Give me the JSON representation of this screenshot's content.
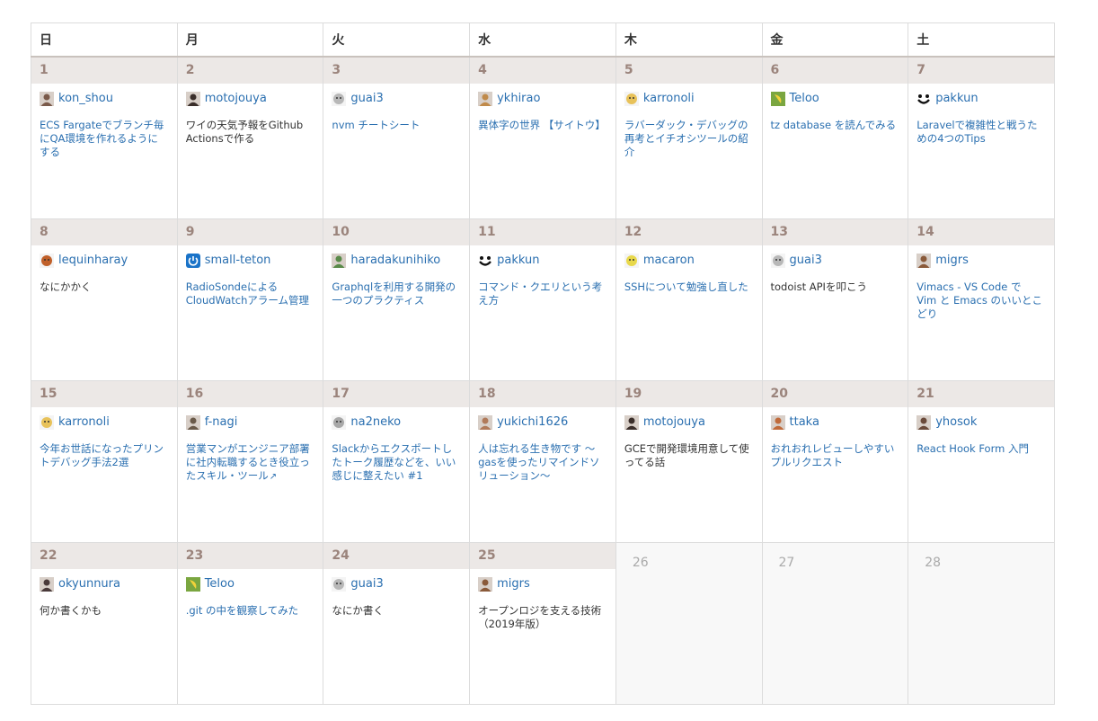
{
  "weekdays": [
    "日",
    "月",
    "火",
    "水",
    "木",
    "金",
    "土"
  ],
  "colors": {
    "link": "#2a6fb0",
    "day_header_bg": "#ece8e6",
    "day_number": "#9b847c",
    "empty_cell_bg": "#f8f8f8"
  },
  "weeks": [
    [
      {
        "day": "1",
        "author": "kon_shou",
        "avatar": "photo-avatar",
        "avatar_color": "#7a5a4a",
        "title": "ECS Fargateでブランチ毎にQA環境を作れるようにする",
        "linked": true
      },
      {
        "day": "2",
        "author": "motojouya",
        "avatar": "photo-avatar",
        "avatar_color": "#3a2e2a",
        "title": "ワイの天気予報をGithub Actionsで作る",
        "linked": false
      },
      {
        "day": "3",
        "author": "guai3",
        "avatar": "character-avatar",
        "avatar_color": "#b8b8b8",
        "title": "nvm チートシート",
        "linked": true
      },
      {
        "day": "4",
        "author": "ykhirao",
        "avatar": "photo-avatar",
        "avatar_color": "#c08a4a",
        "title": "異体字の世界 【サイトウ】",
        "linked": true
      },
      {
        "day": "5",
        "author": "karronoli",
        "avatar": "character-avatar",
        "avatar_color": "#e8c25a",
        "title": "ラバーダック・デバッグの再考とイチオシツールの紹介",
        "linked": true
      },
      {
        "day": "6",
        "author": "Teloo",
        "avatar": "banana-avatar",
        "avatar_color": "#7aa640",
        "title": "tz database を読んでみる",
        "linked": true
      },
      {
        "day": "7",
        "author": "pakkun",
        "avatar": "smiley-avatar",
        "avatar_color": "#111111",
        "title": "Laravelで複雑性と戦うための4つのTips",
        "linked": true
      }
    ],
    [
      {
        "day": "8",
        "author": "lequinharay",
        "avatar": "character-avatar",
        "avatar_color": "#c0602a",
        "title": "なにかかく",
        "linked": false
      },
      {
        "day": "9",
        "author": "small-teton",
        "avatar": "power-avatar",
        "avatar_color": "#1a73c8",
        "title": "RadioSondeによるCloudWatchアラーム管理",
        "linked": true
      },
      {
        "day": "10",
        "author": "haradakunihiko",
        "avatar": "photo-avatar",
        "avatar_color": "#5a8a4a",
        "title": "Graphqlを利用する開発の一つのプラクティス",
        "linked": true
      },
      {
        "day": "11",
        "author": "pakkun",
        "avatar": "smiley-avatar",
        "avatar_color": "#111111",
        "title": "コマンド・クエリという考え方",
        "linked": true
      },
      {
        "day": "12",
        "author": "macaron",
        "avatar": "character-avatar",
        "avatar_color": "#e8d84a",
        "title": "SSHについて勉強し直した",
        "linked": true
      },
      {
        "day": "13",
        "author": "guai3",
        "avatar": "character-avatar",
        "avatar_color": "#b8b8b8",
        "title": "todoist APIを叩こう",
        "linked": false
      },
      {
        "day": "14",
        "author": "migrs",
        "avatar": "photo-avatar",
        "avatar_color": "#8a5a3a",
        "title": "Vimacs - VS Code で Vim と Emacs のいいとこどり",
        "linked": true
      }
    ],
    [
      {
        "day": "15",
        "author": "karronoli",
        "avatar": "character-avatar",
        "avatar_color": "#e8c25a",
        "title": "今年お世話になったプリントデバッグ手法2選",
        "linked": true
      },
      {
        "day": "16",
        "author": "f-nagi",
        "avatar": "photo-avatar",
        "avatar_color": "#6a5a4a",
        "title": "営業マンがエンジニア部署に社内転職するとき役立ったスキル・ツール",
        "linked": true,
        "external": true
      },
      {
        "day": "17",
        "author": "na2neko",
        "avatar": "character-avatar",
        "avatar_color": "#a8a8a8",
        "title": "Slackからエクスポートしたトーク履歴などを、いい感じに整えたい #1",
        "linked": true
      },
      {
        "day": "18",
        "author": "yukichi1626",
        "avatar": "photo-avatar",
        "avatar_color": "#b07a5a",
        "title": "人は忘れる生き物です 〜gasを使ったリマインドソリューション〜",
        "linked": true
      },
      {
        "day": "19",
        "author": "motojouya",
        "avatar": "photo-avatar",
        "avatar_color": "#3a2e2a",
        "title": "GCEで開発環境用意して使ってる話",
        "linked": false
      },
      {
        "day": "20",
        "author": "ttaka",
        "avatar": "photo-avatar",
        "avatar_color": "#c06a3a",
        "title": "おれおれレビューしやすいプルリクエスト",
        "linked": true
      },
      {
        "day": "21",
        "author": "yhosok",
        "avatar": "photo-avatar",
        "avatar_color": "#6a4a3a",
        "title": "React Hook Form 入門",
        "linked": true
      }
    ],
    [
      {
        "day": "22",
        "author": "okyunnura",
        "avatar": "photo-avatar",
        "avatar_color": "#4a3a3a",
        "title": "何か書くかも",
        "linked": false
      },
      {
        "day": "23",
        "author": "Teloo",
        "avatar": "banana-avatar",
        "avatar_color": "#7aa640",
        "title": ".git の中を観察してみた",
        "linked": true
      },
      {
        "day": "24",
        "author": "guai3",
        "avatar": "character-avatar",
        "avatar_color": "#b8b8b8",
        "title": "なにか書く",
        "linked": false
      },
      {
        "day": "25",
        "author": "migrs",
        "avatar": "photo-avatar",
        "avatar_color": "#8a5a3a",
        "title": "オープンロジを支える技術（2019年版）",
        "linked": false
      },
      {
        "day": "26",
        "empty": true
      },
      {
        "day": "27",
        "empty": true
      },
      {
        "day": "28",
        "empty": true
      }
    ]
  ]
}
